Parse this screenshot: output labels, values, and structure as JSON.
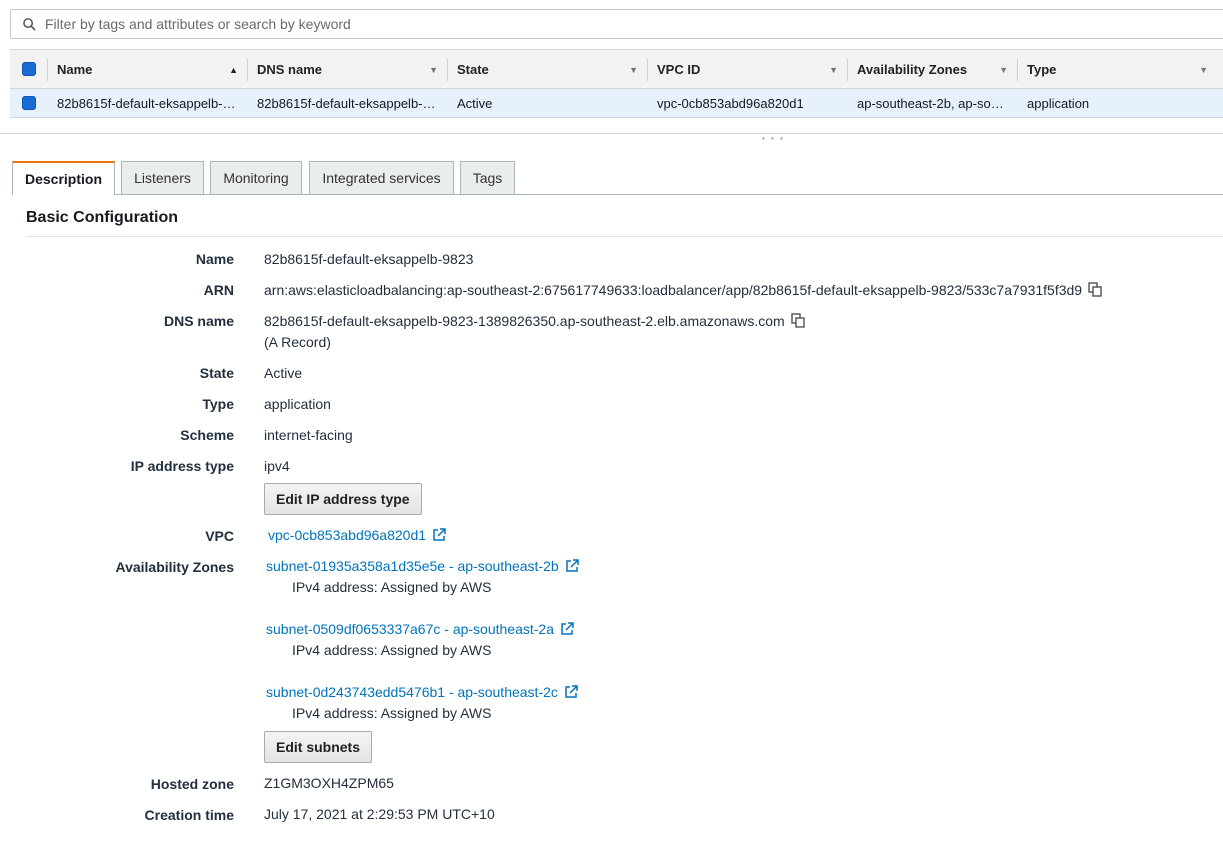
{
  "search": {
    "placeholder": "Filter by tags and attributes or search by keyword"
  },
  "table": {
    "columns": [
      {
        "label": "Name",
        "sort": "asc"
      },
      {
        "label": "DNS name",
        "sort": "none"
      },
      {
        "label": "State",
        "sort": "none"
      },
      {
        "label": "VPC ID",
        "sort": "none"
      },
      {
        "label": "Availability Zones",
        "sort": "none"
      },
      {
        "label": "Type",
        "sort": "none"
      }
    ],
    "rows": [
      {
        "name": "82b8615f-default-eksappelb-…",
        "dns": "82b8615f-default-eksappelb-…",
        "state": "Active",
        "vpc": "vpc-0cb853abd96a820d1",
        "az": "ap-southeast-2b, ap-so…",
        "type": "application",
        "selected": true
      }
    ]
  },
  "tabs": [
    "Description",
    "Listeners",
    "Monitoring",
    "Integrated services",
    "Tags"
  ],
  "active_tab": "Description",
  "basic": {
    "title": "Basic Configuration",
    "name_label": "Name",
    "name": "82b8615f-default-eksappelb-9823",
    "arn_label": "ARN",
    "arn": "arn:aws:elasticloadbalancing:ap-southeast-2:675617749633:loadbalancer/app/82b8615f-default-eksappelb-9823/533c7a7931f5f3d9",
    "dns_label": "DNS name",
    "dns": "82b8615f-default-eksappelb-9823-1389826350.ap-southeast-2.elb.amazonaws.com",
    "dns_note": "(A Record)",
    "state_label": "State",
    "state": "Active",
    "type_label": "Type",
    "type": "application",
    "scheme_label": "Scheme",
    "scheme": "internet-facing",
    "ip_label": "IP address type",
    "ip": "ipv4",
    "edit_ip_button": "Edit IP address type",
    "vpc_label": "VPC",
    "vpc": "vpc-0cb853abd96a820d1",
    "az_label": "Availability Zones",
    "subnets": [
      {
        "link": "subnet-01935a358a1d35e5e - ap-southeast-2b",
        "ipv4": "IPv4 address: Assigned by AWS"
      },
      {
        "link": "subnet-0509df0653337a67c - ap-southeast-2a",
        "ipv4": "IPv4 address: Assigned by AWS"
      },
      {
        "link": "subnet-0d243743edd5476b1 - ap-southeast-2c",
        "ipv4": "IPv4 address: Assigned by AWS"
      }
    ],
    "edit_subnets_button": "Edit subnets",
    "hosted_zone_label": "Hosted zone",
    "hosted_zone": "Z1GM3OXH4ZPM65",
    "creation_label": "Creation time",
    "creation": "July 17, 2021 at 2:29:53 PM UTC+10"
  },
  "colors": {
    "accent": "#ec7211",
    "link": "#0073bb",
    "selected_row": "#e7f1fb",
    "checkbox": "#1a6bd6"
  }
}
